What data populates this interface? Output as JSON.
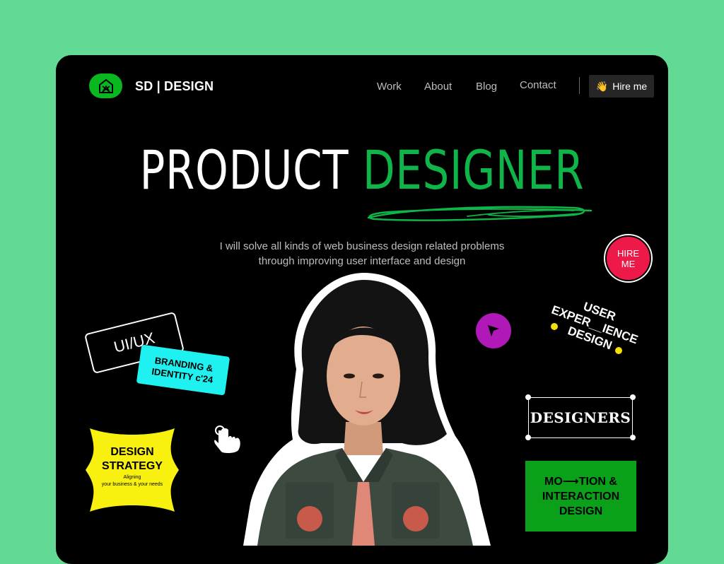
{
  "header": {
    "brand": "SD | DESIGN",
    "nav": [
      "Work",
      "About",
      "Blog",
      "Contact"
    ],
    "hire_button": "Hire me",
    "hire_emoji": "👋"
  },
  "hero": {
    "title_part1": "PRODUCT",
    "title_part2": "DESIGNER",
    "subtitle_line1": "I will solve all kinds of web business  design  related problems",
    "subtitle_line2": "through improving user interface and design"
  },
  "stickers": {
    "hire_circle_line1": "HIRE",
    "hire_circle_line2": "ME",
    "uiux": "UI/UX",
    "branding_line1": "BRANDING &",
    "branding_line2": "IDENTITY c'24",
    "strategy_line1": "DESIGN",
    "strategy_line2": "STRATEGY",
    "strategy_sub_line1": "Aligning",
    "strategy_sub_line2": "your business & your needs",
    "ux_line1": "USER",
    "ux_line2": "EXPER__IENCE",
    "ux_line3": "DESIGN",
    "designers": "DESIGNERS",
    "motion_line1": "MO⟶TION &",
    "motion_line2": "INTERACTION",
    "motion_line3": "DESIGN"
  },
  "colors": {
    "background": "#62d995",
    "accent_green": "#0fb548",
    "hire_red": "#ed1949",
    "cyan": "#1ff0f0",
    "yellow": "#f8f00e",
    "magenta": "#b118b8",
    "motion_green": "#0aa01a"
  },
  "icons": [
    "logo-house-icon",
    "waving-hand-icon",
    "pointer-arrow-icon",
    "hand-cursor-icon"
  ]
}
